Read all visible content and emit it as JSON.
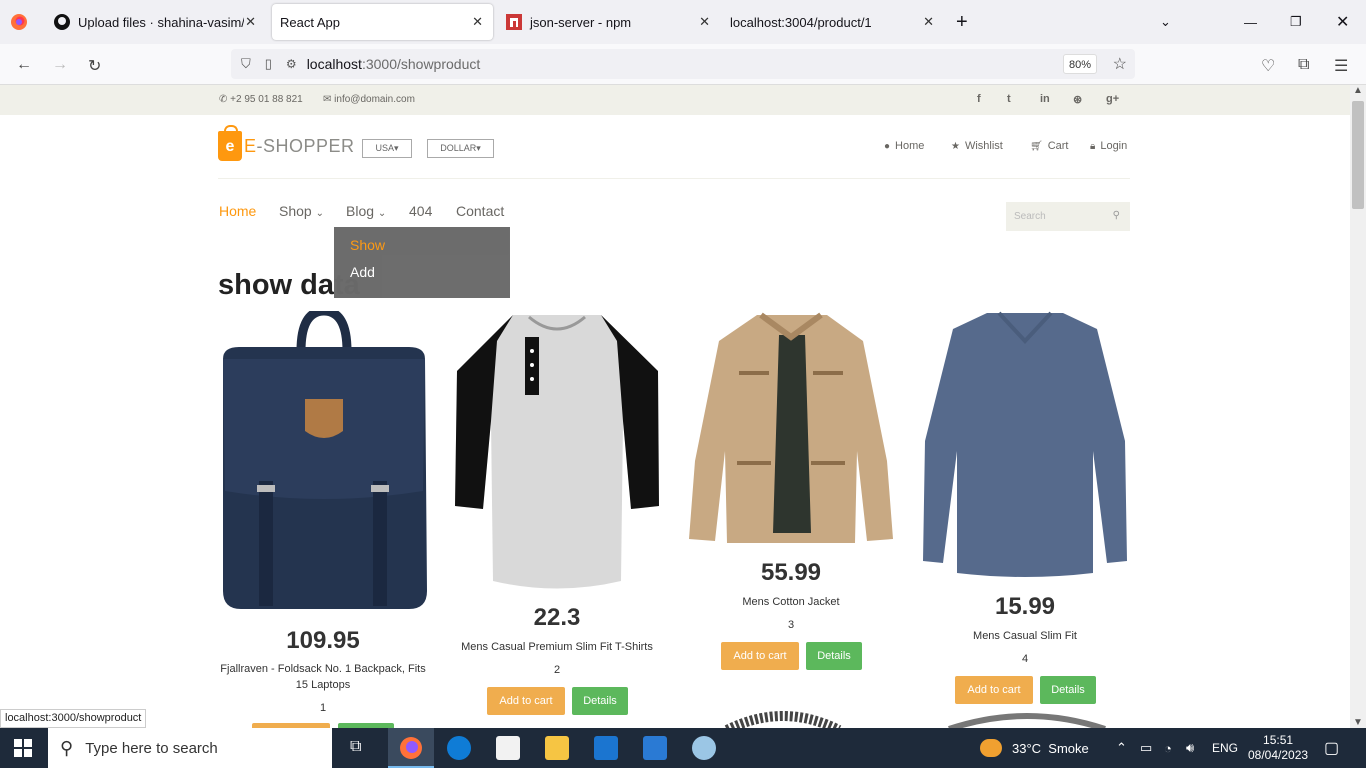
{
  "browser": {
    "tabs": [
      {
        "title": "Upload files · shahina-vasim/Re",
        "icon": "github-icon"
      },
      {
        "title": "React App",
        "icon": ""
      },
      {
        "title": "json-server - npm",
        "icon": "npm-icon"
      },
      {
        "title": "localhost:3004/product/1",
        "icon": ""
      }
    ],
    "url_host": "localhost",
    "url_path": ":3000/showproduct",
    "zoom": "80%",
    "status_url": "localhost:3000/showproduct"
  },
  "topbar": {
    "phone": "+2 95 01 88 821",
    "email": "info@domain.com",
    "social": [
      "f",
      "t",
      "in",
      "⊛",
      "g+"
    ]
  },
  "header": {
    "logo_letter": "e",
    "logo_text": "-SHOPPER",
    "logo_prefix": "E",
    "country": "USA",
    "currency": "DOLLAR",
    "nav": [
      "Home",
      "Wishlist",
      "Cart",
      "Login"
    ]
  },
  "menu": {
    "items": [
      "Home",
      "Shop",
      "Blog",
      "404",
      "Contact"
    ],
    "active": "Home",
    "dropdown": [
      "Show",
      "Add"
    ],
    "search_placeholder": "Search"
  },
  "page_title": "show data",
  "products": [
    {
      "price": "109.95",
      "name": "Fjallraven - Foldsack No. 1 Backpack, Fits 15 Laptops",
      "id": "1"
    },
    {
      "price": "22.3",
      "name": "Mens Casual Premium Slim Fit T-Shirts",
      "id": "2"
    },
    {
      "price": "55.99",
      "name": "Mens Cotton Jacket",
      "id": "3"
    },
    {
      "price": "15.99",
      "name": "Mens Casual Slim Fit",
      "id": "4"
    }
  ],
  "buttons": {
    "add_to_cart": "Add to cart",
    "details": "Details"
  },
  "taskbar": {
    "search_placeholder": "Type here to search",
    "weather": "33°C  Smoke",
    "lang": "ENG",
    "time": "15:51",
    "date": "08/04/2023"
  },
  "colors": {
    "accent": "#fe980f",
    "cart_button": "#f0ad4e",
    "details_button": "#5cb85c"
  }
}
